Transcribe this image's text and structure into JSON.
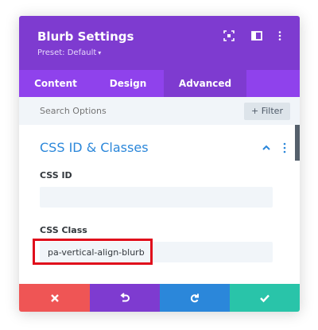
{
  "colors": {
    "header": "#7e3bd0",
    "tabs": "#8f42ec",
    "accent_blue": "#2b87da",
    "cancel": "#ef5555",
    "undo": "#7e3bd0",
    "redo": "#2b87da",
    "save": "#29c4a9",
    "highlight": "#e00d1b"
  },
  "header": {
    "title": "Blurb Settings",
    "preset": "Preset: Default",
    "icons": [
      "fullscreen-icon",
      "split-view-icon",
      "more-options-icon"
    ]
  },
  "tabs": [
    {
      "label": "Content",
      "active": false
    },
    {
      "label": "Design",
      "active": false
    },
    {
      "label": "Advanced",
      "active": true
    }
  ],
  "search": {
    "placeholder": "Search Options",
    "filter_label": "+ Filter"
  },
  "section": {
    "title": "CSS ID & Classes",
    "fields": [
      {
        "label": "CSS ID",
        "value": ""
      },
      {
        "label": "CSS Class",
        "value": "pa-vertical-align-blurb"
      }
    ]
  },
  "footer": {
    "buttons": [
      "cancel-icon",
      "undo-icon",
      "redo-icon",
      "save-check-icon"
    ]
  }
}
